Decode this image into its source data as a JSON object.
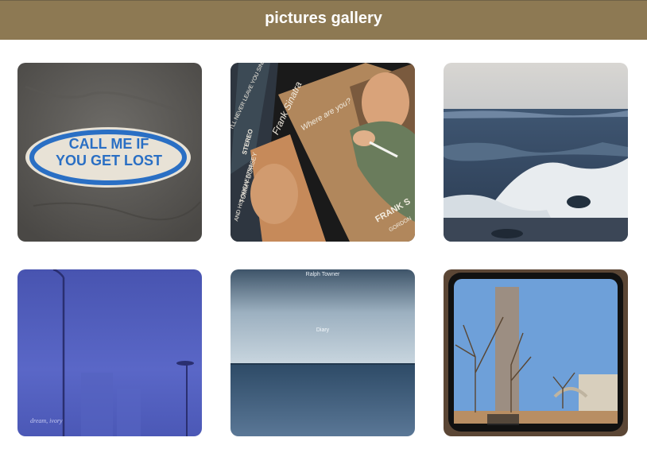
{
  "header": {
    "title": "pictures gallery",
    "background": "#8d7953",
    "title_color": "#ffffff"
  },
  "gallery": {
    "items": [
      {
        "name": "patch-call-me-if-you-get-lost",
        "patch_line1": "CALL ME IF",
        "patch_line2": "YOU GET LOST"
      },
      {
        "name": "frank-sinatra-records",
        "album_text1": "Frank Sinatra",
        "album_text2": "Where are you?",
        "album_text3": "FRANK S",
        "album_text4": "STEREO",
        "album_text5": "TOMMY DORSEY",
        "album_text6": "I'LL NEVER LEAVE YOU SINATRA",
        "album_text7": "AND HIS ORCHESTRA",
        "album_text8": "GORDON"
      },
      {
        "name": "ocean-waves"
      },
      {
        "name": "blue-fog-streetlights",
        "caption": "dream, ivory"
      },
      {
        "name": "ralph-towner-diary",
        "artist": "Ralph Towner",
        "album": "Diary"
      },
      {
        "name": "window-view-trees"
      }
    ]
  }
}
